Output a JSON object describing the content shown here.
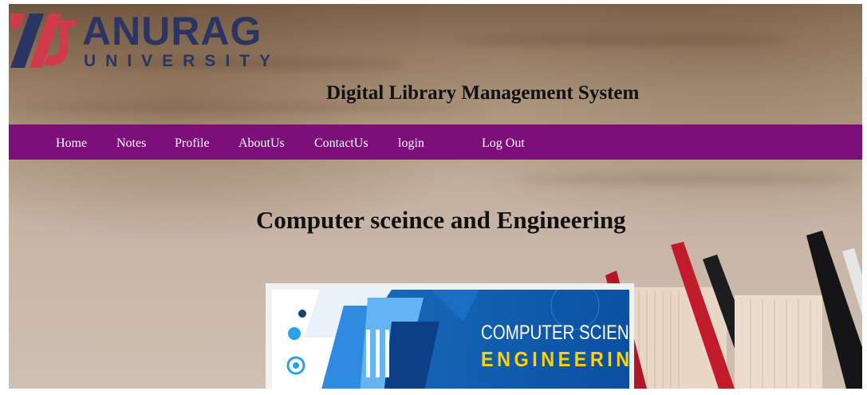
{
  "brand": {
    "name": "ANURAG",
    "subtitle": "UNIVERSITY",
    "colors": {
      "primary": "#2a3563",
      "mark_red": "#d23a4a"
    }
  },
  "header": {
    "site_title": "Digital Library Management System"
  },
  "nav": {
    "background": "#7d0f7a",
    "items": [
      {
        "label": "Home"
      },
      {
        "label": "Notes"
      },
      {
        "label": "Profile"
      },
      {
        "label": "AboutUs"
      },
      {
        "label": "ContactUs"
      },
      {
        "label": "login"
      },
      {
        "label": "Log Out"
      }
    ]
  },
  "main": {
    "heading": "Computer sceince and Engineering",
    "banner": {
      "line1": "COMPUTER SCIENCE",
      "line2": "ENGINEERING",
      "accent": "#ffd200"
    }
  }
}
